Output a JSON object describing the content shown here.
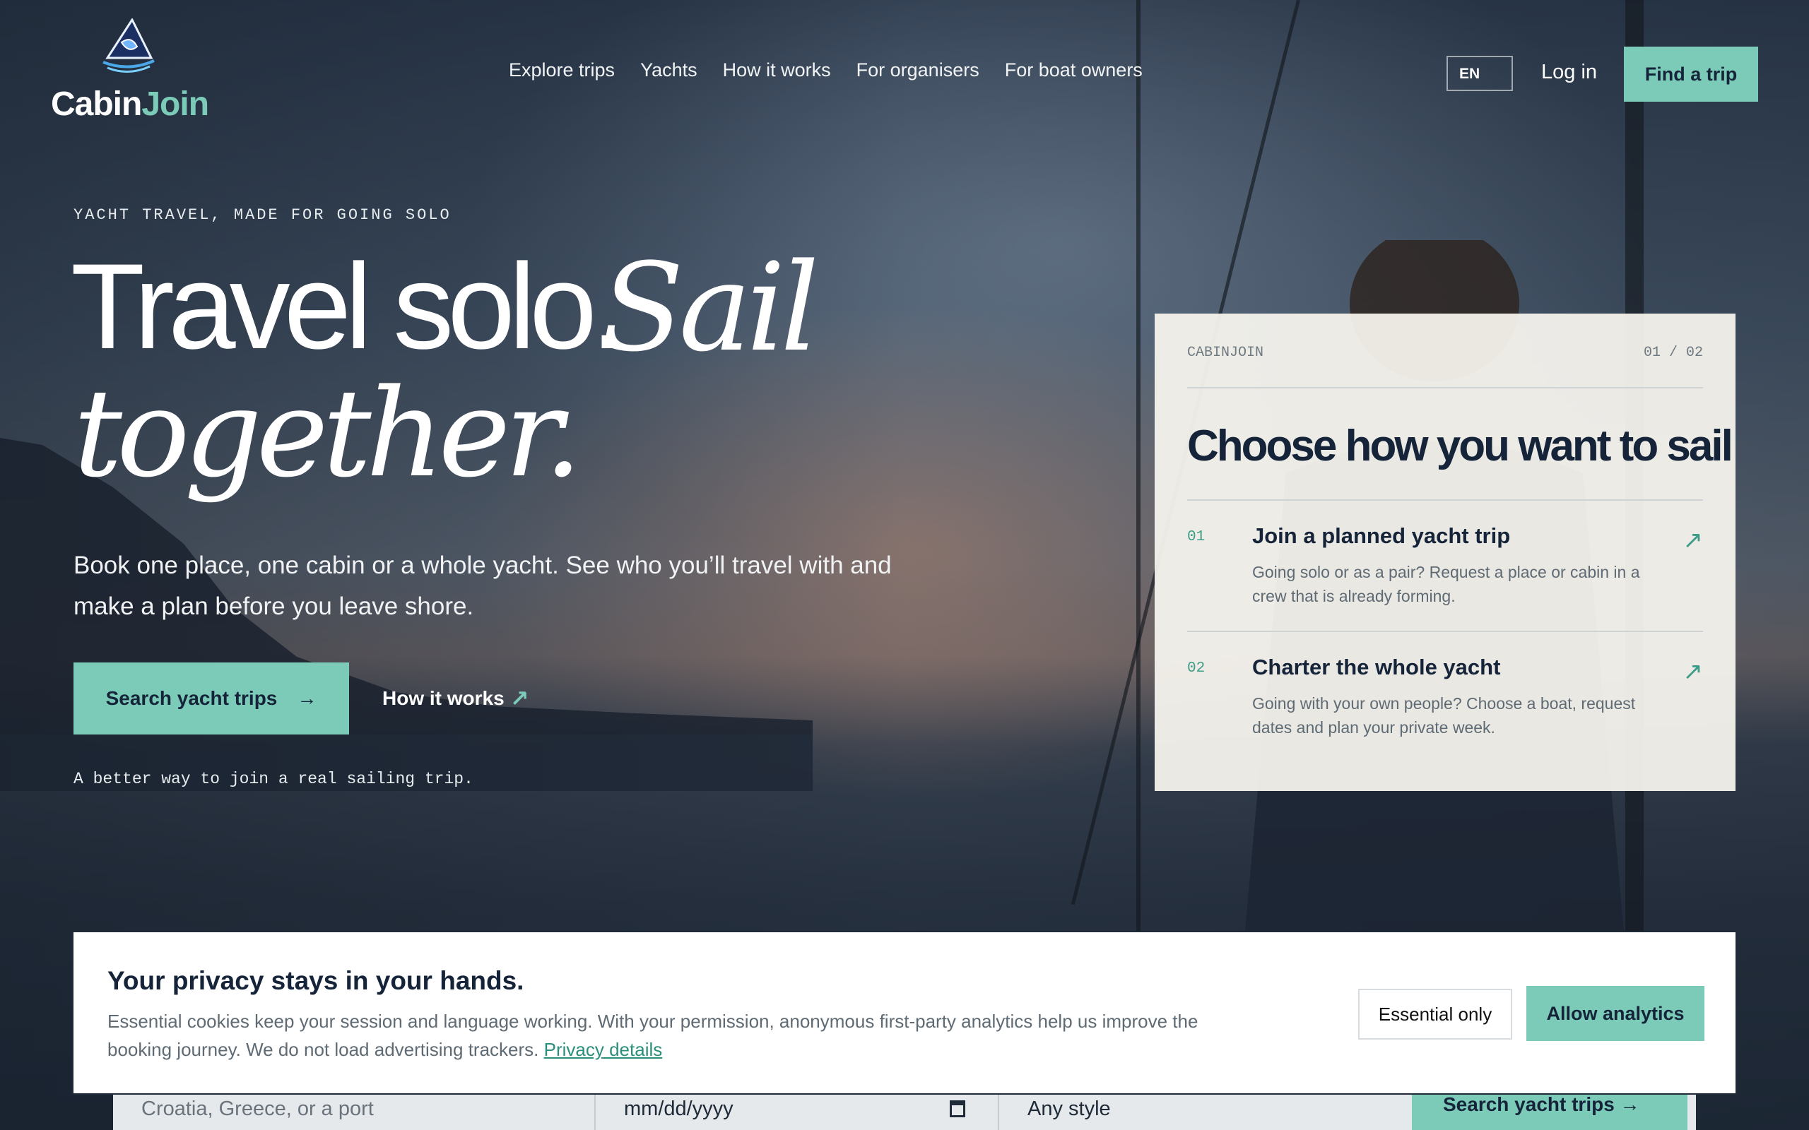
{
  "header": {
    "logo_part1": "Cabin",
    "logo_part2": "Join",
    "nav": [
      "Explore trips",
      "Yachts",
      "How it works",
      "For organisers",
      "For boat owners"
    ],
    "lang": "EN",
    "login": "Log in",
    "cta": "Find a trip"
  },
  "hero": {
    "eyebrow": "YACHT TRAVEL, MADE FOR GOING SOLO",
    "title_plain": "Travel solo.",
    "title_italic_1": "Sail",
    "title_italic_2": "together.",
    "lede": "Book one place, one cabin or a whole yacht. See who you’ll travel with and make a plan before you leave shore.",
    "primary_cta": "Search yacht trips",
    "primary_cta_icon": "→",
    "secondary_cta": "How it works",
    "secondary_cta_icon": "↗",
    "tagline": "A better way to join a real sailing trip."
  },
  "card": {
    "brand": "CABINJOIN",
    "pager": "01 / 02",
    "title": "Choose how you want to sail",
    "options": [
      {
        "num": "01",
        "title": "Join a planned yacht trip",
        "desc": "Going solo or as a pair? Request a place or cabin in a crew that is already forming.",
        "icon": "↗"
      },
      {
        "num": "02",
        "title": "Charter the whole yacht",
        "desc": "Going with your own people? Choose a boat, request dates and plan your private week.",
        "icon": "↗"
      }
    ]
  },
  "searchbar": {
    "destination_placeholder": "Croatia, Greece, or a port",
    "date_value": "mm/dd/yyyy",
    "style_value": "Any style",
    "button": "Search yacht trips →"
  },
  "cookie": {
    "title": "Your privacy stays in your hands.",
    "body": "Essential cookies keep your session and language working. With your permission, anonymous first-party analytics help us improve the booking journey. We do not load advertising trackers.",
    "link": "Privacy details",
    "essential_btn": "Essential only",
    "allow_btn": "Allow analytics"
  },
  "colors": {
    "accent": "#7ccbb9",
    "navy": "#16243a",
    "card_bg": "#f6f4ee"
  }
}
